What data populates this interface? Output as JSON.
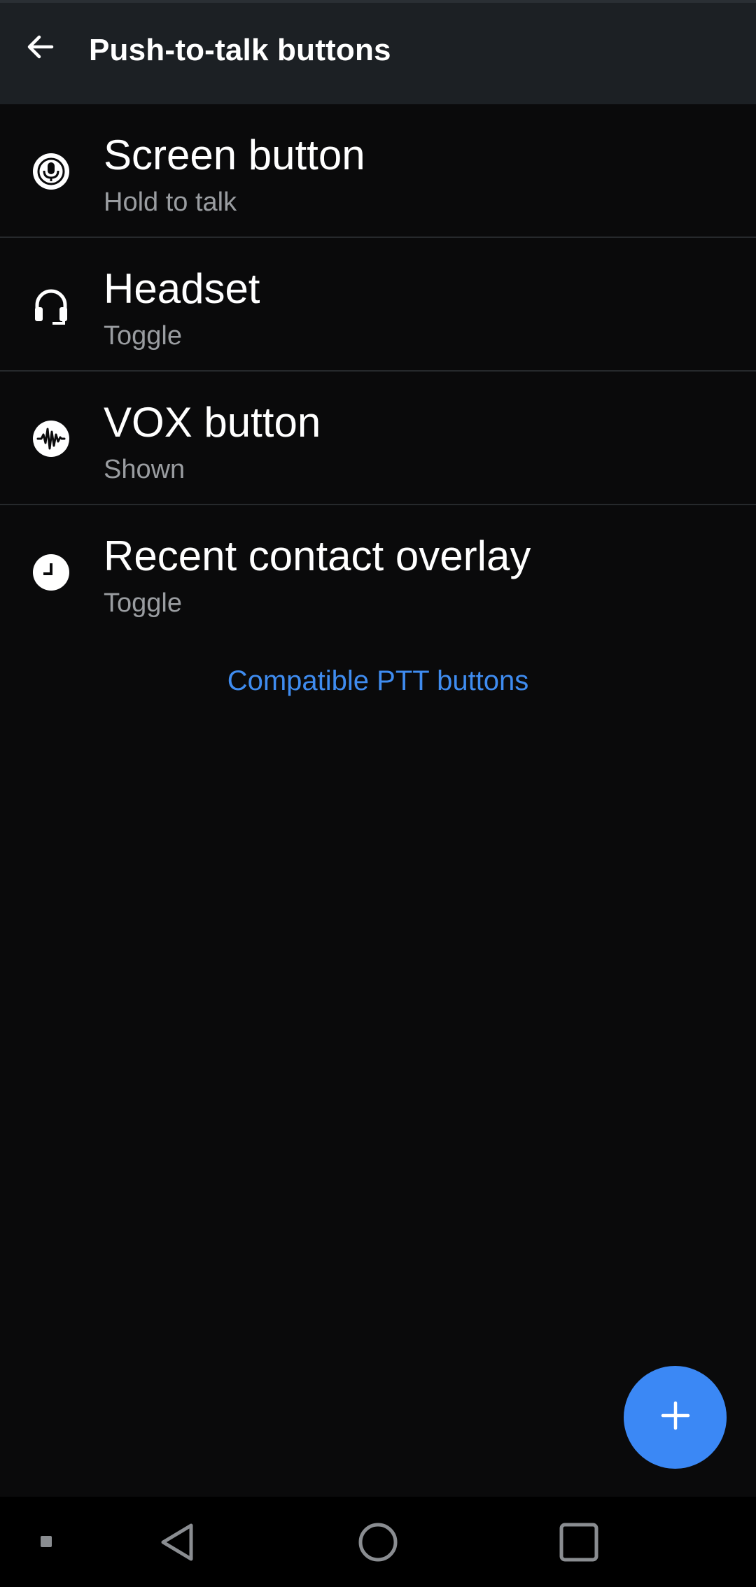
{
  "header": {
    "title": "Push-to-talk buttons",
    "back_icon": "arrow-back-icon"
  },
  "items": [
    {
      "title": "Screen button",
      "subtitle": "Hold to talk",
      "icon": "mic-circle-icon"
    },
    {
      "title": "Headset",
      "subtitle": "Toggle",
      "icon": "headset-icon"
    },
    {
      "title": "VOX button",
      "subtitle": "Shown",
      "icon": "waveform-icon"
    },
    {
      "title": "Recent contact overlay",
      "subtitle": "Toggle",
      "icon": "clock-icon"
    }
  ],
  "link": {
    "label": "Compatible PTT buttons"
  },
  "fab": {
    "icon": "plus-icon"
  },
  "navbar": {
    "icons": [
      "dot-icon",
      "back-triangle-icon",
      "home-circle-icon",
      "recents-square-icon"
    ]
  },
  "colors": {
    "accent": "#3b88f5",
    "link": "#3f8cf0",
    "app_bar": "#1c2024",
    "background": "#0a0a0b",
    "subtitle": "#9a9da1"
  }
}
